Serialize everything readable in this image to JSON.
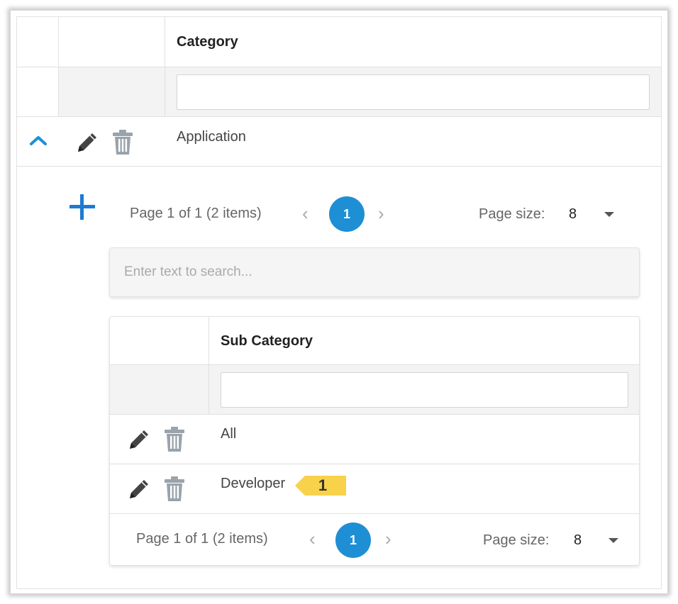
{
  "main_grid": {
    "header": {
      "category_label": "Category"
    },
    "filter": {
      "category_value": ""
    },
    "rows": [
      {
        "category": "Application",
        "expanded": true
      }
    ]
  },
  "detail": {
    "toolbar": {
      "pager": {
        "summary": "Page 1 of 1 (2 items)",
        "current_page": "1",
        "page_size_label": "Page size:",
        "page_size_value": "8"
      }
    },
    "search": {
      "placeholder": "Enter text to search..."
    },
    "subgrid": {
      "header": {
        "sub_category_label": "Sub Category"
      },
      "filter": {
        "sub_category_value": ""
      },
      "rows": [
        {
          "sub_category": "All"
        },
        {
          "sub_category": "Developer"
        }
      ],
      "pager": {
        "summary": "Page 1 of 1 (2 items)",
        "current_page": "1",
        "page_size_label": "Page size:",
        "page_size_value": "8"
      }
    }
  },
  "annotation": {
    "callout_number": "1",
    "callout_color": "#f8d24a"
  },
  "colors": {
    "accent": "#1e8fd5",
    "add_icon": "#1e7ad2"
  }
}
